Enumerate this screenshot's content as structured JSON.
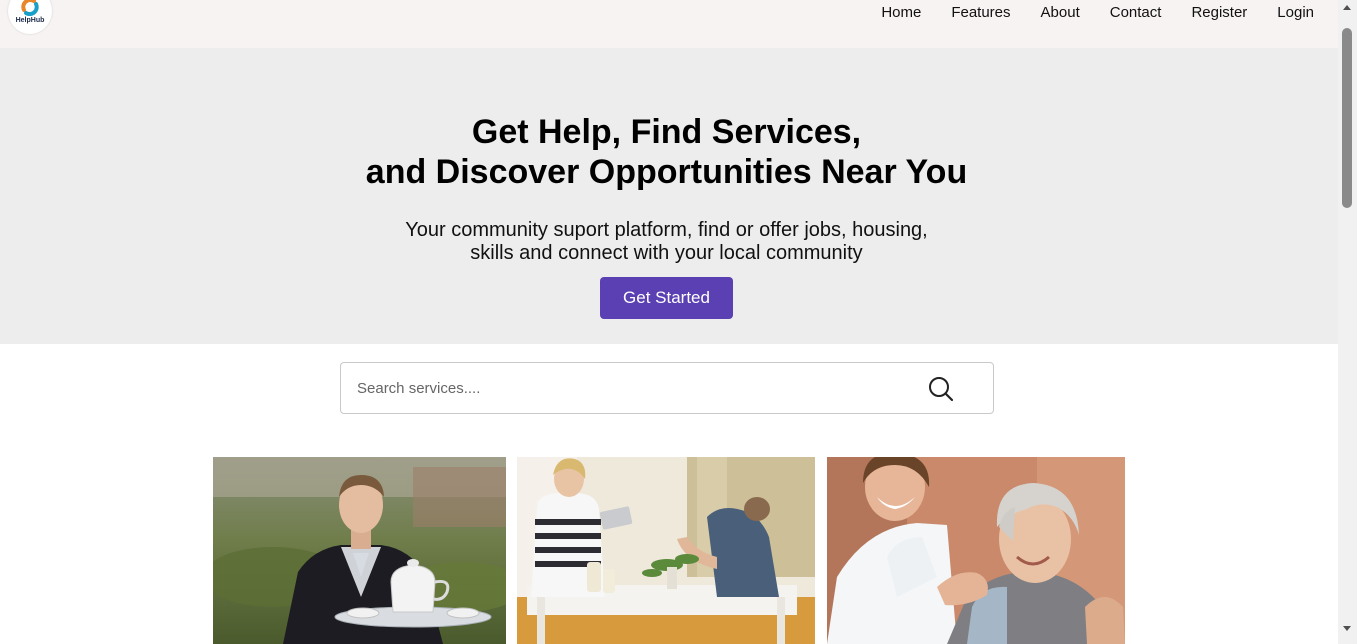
{
  "brand": {
    "name": "HelpHub"
  },
  "nav": {
    "items": [
      "Home",
      "Features",
      "About",
      "Contact",
      "Register",
      "Login"
    ]
  },
  "hero": {
    "title_line1": "Get Help, Find Services,",
    "title_line2": "and Discover Opportunities Near You",
    "subtitle_line1": "Your community suport platform, find or offer jobs, housing,",
    "subtitle_line2": "skills and connect with your local community",
    "cta_label": "Get Started"
  },
  "search": {
    "placeholder": "Search services....",
    "value": "",
    "icon": "search-icon"
  },
  "cards": [
    {
      "image": "butler-serving-tea-photo"
    },
    {
      "image": "cleaning-service-photo"
    },
    {
      "image": "elderly-care-photo"
    }
  ],
  "colors": {
    "navbar_bg": "#f7f3f2",
    "hero_bg": "#ededed",
    "accent": "#5b40b3"
  }
}
